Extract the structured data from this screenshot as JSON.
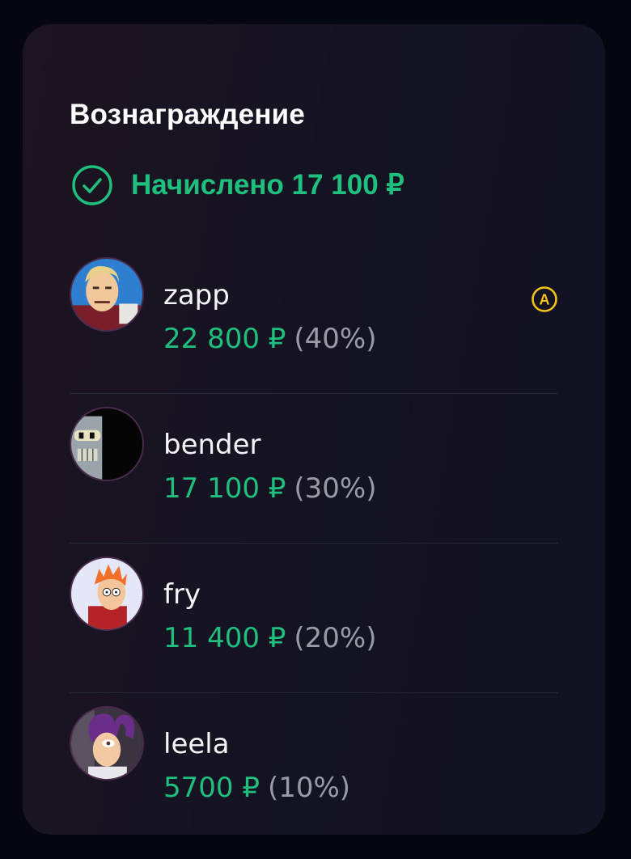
{
  "card": {
    "title": "Вознаграждение",
    "status": {
      "icon": "check-circle-icon",
      "text": "Начислено 17 100 ₽",
      "color": "#1fbf7d"
    }
  },
  "members": [
    {
      "name": "zapp",
      "amount": "22 800 ₽",
      "percent": "(40%)",
      "avatar": "zapp-avatar",
      "badge": "A"
    },
    {
      "name": "bender",
      "amount": "17 100 ₽",
      "percent": "(30%)",
      "avatar": "bender-avatar"
    },
    {
      "name": "fry",
      "amount": "11 400 ₽",
      "percent": "(20%)",
      "avatar": "fry-avatar"
    },
    {
      "name": "leela",
      "amount": "5700 ₽",
      "percent": "(10%)",
      "avatar": "leela-avatar"
    }
  ],
  "colors": {
    "background": "#060611",
    "card": "#151322",
    "accent_green": "#1fbf7d",
    "muted": "#9a9aa6",
    "badge_yellow": "#f2c318"
  }
}
